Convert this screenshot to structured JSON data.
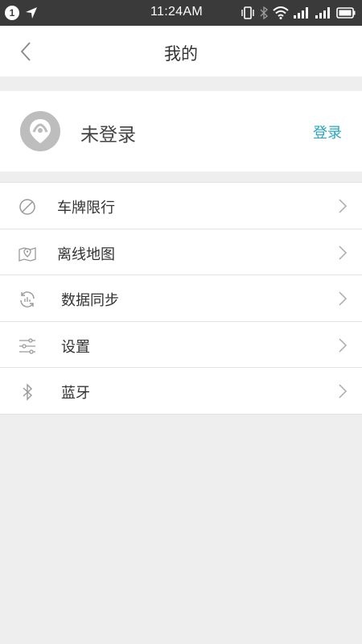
{
  "status_bar": {
    "notification_count": "1",
    "time": "11:24AM"
  },
  "header": {
    "title": "我的"
  },
  "profile": {
    "name": "未登录",
    "login_label": "登录"
  },
  "menu": {
    "items": [
      {
        "label": "车牌限行",
        "icon": "no-entry-icon"
      },
      {
        "label": "离线地图",
        "icon": "map-pin-icon"
      },
      {
        "label": "数据同步",
        "icon": "sync-icon"
      },
      {
        "label": "设置",
        "icon": "sliders-icon"
      },
      {
        "label": "蓝牙",
        "icon": "bluetooth-icon"
      }
    ]
  },
  "colors": {
    "accent": "#29a4c0",
    "status_bar": "#3a3a3a",
    "background": "#eeeeee"
  }
}
